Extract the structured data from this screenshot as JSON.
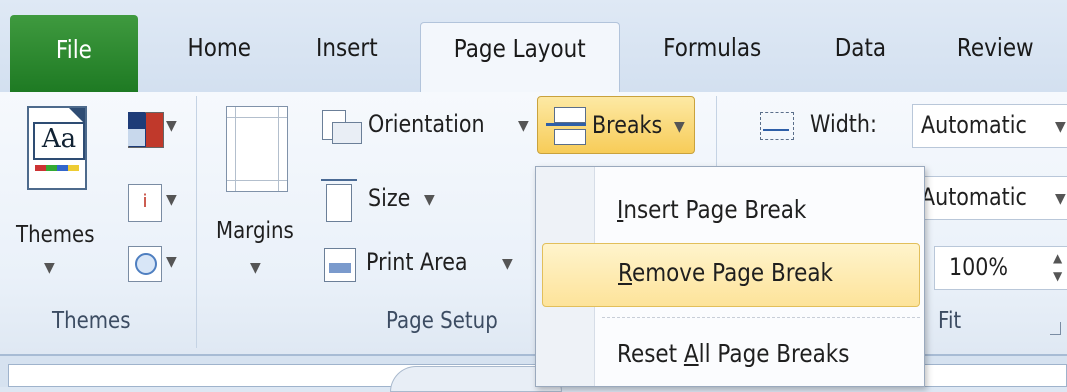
{
  "tabs": {
    "file": "File",
    "home": "Home",
    "insert": "Insert",
    "page_layout": "Page Layout",
    "formulas": "Formulas",
    "data": "Data",
    "review": "Review"
  },
  "groups": {
    "themes": {
      "label": "Themes",
      "themes_button": "Themes"
    },
    "page_setup": {
      "label": "Page Setup",
      "margins": "Margins",
      "orientation": "Orientation",
      "size": "Size",
      "print_area": "Print Area",
      "breaks": "Breaks"
    },
    "scale_to_fit": {
      "label": "Fit",
      "width_label": "Width:",
      "width_value": "Automatic",
      "height_value": "Automatic",
      "scale_value": "100%"
    }
  },
  "breaks_menu": {
    "items": [
      {
        "label": "Insert Page Break",
        "mnemonic": "I",
        "rest": "nsert Page Break"
      },
      {
        "label": "Remove Page Break",
        "mnemonic": "R",
        "rest": "emove Page Break"
      },
      {
        "label": "Reset All Page Breaks",
        "pre": "Reset ",
        "mnemonic": "A",
        "rest": "ll Page Breaks"
      }
    ],
    "highlighted_index": 1
  },
  "colors": {
    "file_tab": "#2a8a2e",
    "highlight": "#f7d26a",
    "ribbon_bg": "#eef3fa"
  }
}
